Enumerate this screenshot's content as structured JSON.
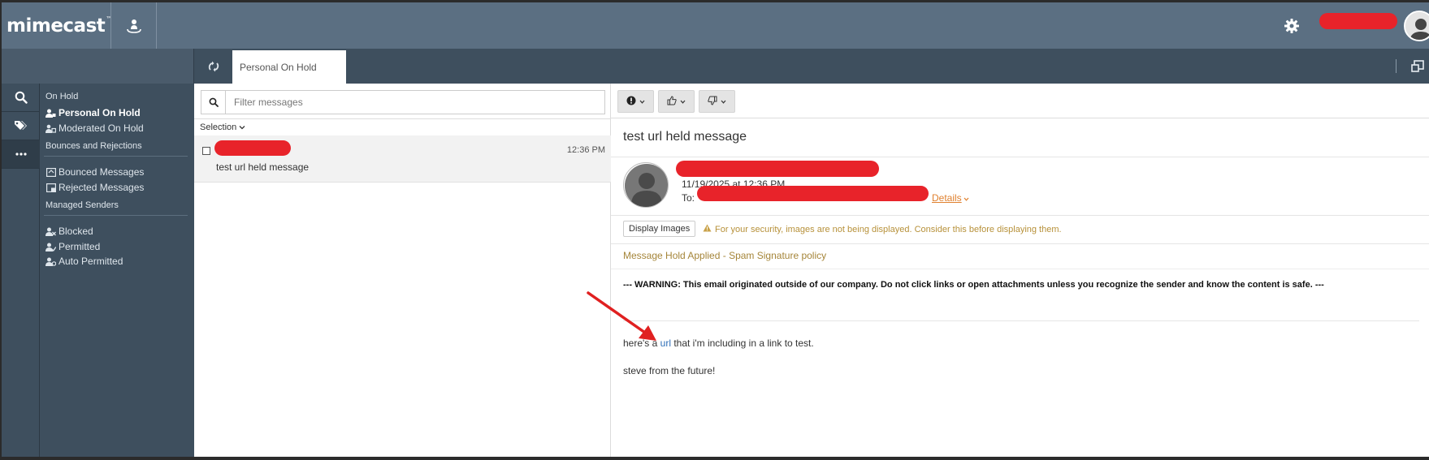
{
  "app": {
    "brand": "mimecast",
    "brand_tm": "™"
  },
  "tabs": [
    {
      "label": "Personal On Hold"
    }
  ],
  "nav": {
    "section_on_hold": "On Hold",
    "personal_on_hold": "Personal On Hold",
    "moderated_on_hold": "Moderated On Hold",
    "section_bounces": "Bounces and Rejections",
    "bounced_messages": "Bounced Messages",
    "rejected_messages": "Rejected Messages",
    "section_managed": "Managed Senders",
    "blocked": "Blocked",
    "permitted": "Permitted",
    "auto_permitted": "Auto Permitted"
  },
  "list": {
    "filter_placeholder": "Filter messages",
    "selection_label": "Selection",
    "messages": [
      {
        "time": "12:36 PM",
        "subject": "test url held message"
      }
    ]
  },
  "message": {
    "subject": "test url held message",
    "date": "11/19/2025 at 12:36 PM",
    "to_label": "To:",
    "details_label": "Details",
    "display_images_label": "Display Images",
    "security_note": "For your security, images are not being displayed. Consider this before displaying them.",
    "hold_note": "Message Hold Applied - Spam Signature policy",
    "warning": "--- WARNING: This email originated outside of our company. Do not click links or open attachments unless you recognize the sender and know the content is safe. ---",
    "body_before_link": "here's a ",
    "body_link": "url",
    "body_after_link": " that i'm including in a link to test.",
    "signature": "steve from the future!"
  },
  "colors": {
    "topbar": "#5b6f82",
    "sidebar": "#3e4f5e",
    "redaction": "#e8232a",
    "link": "#2f6fb8",
    "accent_orange": "#e0812f",
    "hold_note": "#a58539"
  },
  "icons": {
    "top": [
      "person-pin-icon",
      "gear-icon",
      "avatar"
    ],
    "rail": [
      "search-icon",
      "tags-icon",
      "more-icon"
    ],
    "toolbar": [
      "alert-icon",
      "thumbs-up-icon",
      "thumbs-down-icon"
    ]
  }
}
